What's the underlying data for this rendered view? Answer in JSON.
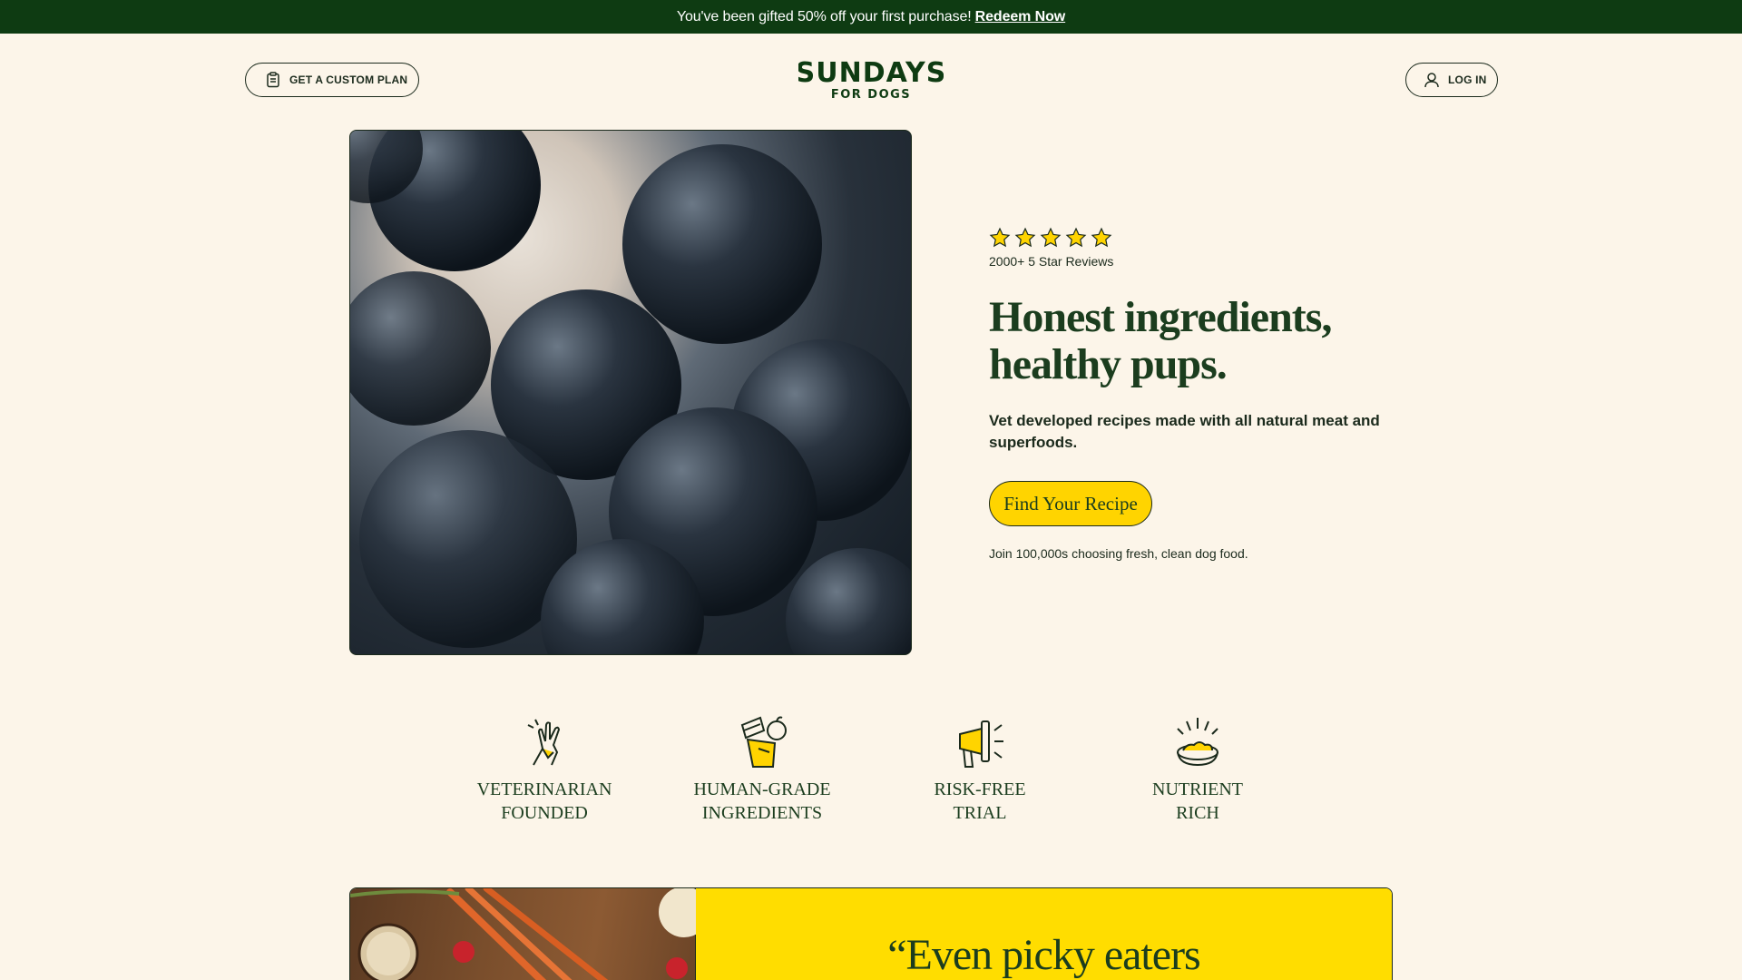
{
  "promo": {
    "text": "You've been gifted 50% off your first purchase!",
    "link": "Redeem Now"
  },
  "header": {
    "plan_button": "GET A CUSTOM PLAN",
    "logo_line1": "SUNDAYS",
    "logo_line2": "FOR DOGS",
    "login_button": "LOG IN"
  },
  "hero": {
    "rating_stars": 5,
    "reviews": "2000+ 5 Star Reviews",
    "headline_line1": "Honest ingredients,",
    "headline_line2": "healthy pups.",
    "subhead": "Vet developed recipes made with all natural meat and superfoods.",
    "cta": "Find Your Recipe",
    "join": "Join 100,000s choosing fresh, clean dog food."
  },
  "features": [
    {
      "label": "VETERINARIAN\nFOUNDED",
      "icon": "high-five-icon"
    },
    {
      "label": "HUMAN-GRADE\nINGREDIENTS",
      "icon": "ingredients-icon"
    },
    {
      "label": "RISK-FREE\nTRIAL",
      "icon": "megaphone-icon"
    },
    {
      "label": "NUTRIENT\nRICH",
      "icon": "food-bowl-icon"
    }
  ],
  "testimonial": {
    "quote": "“Even picky eaters"
  },
  "colors": {
    "promo_bg": "#0e3b12",
    "page_bg": "#fcf5e9",
    "accent_yellow": "#ffd400",
    "brand_green": "#1b3d1e"
  }
}
